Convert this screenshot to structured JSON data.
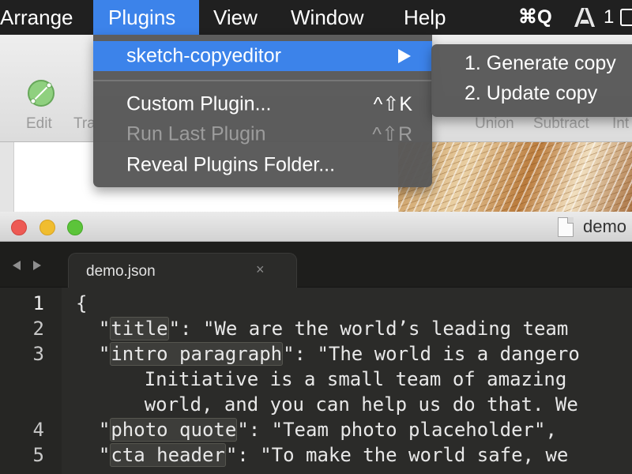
{
  "menubar": {
    "items": [
      {
        "label": "Arrange"
      },
      {
        "label": "Plugins"
      },
      {
        "label": "View"
      },
      {
        "label": "Window"
      },
      {
        "label": "Help"
      }
    ],
    "tray": {
      "shortcut_text": "⌘Q",
      "adobe_icon": "adobe-icon",
      "count_text": "1"
    }
  },
  "sketch_toolbar": {
    "left_labels": [
      "Edit",
      "Tra"
    ],
    "right_labels": [
      "Union",
      "Subtract",
      "Int"
    ]
  },
  "plugins_menu": {
    "highlighted": {
      "label": "sketch-copyeditor",
      "icon": "submenu-arrow-icon"
    },
    "items": [
      {
        "label": "Custom Plugin...",
        "shortcut": "^⇧K",
        "enabled": true
      },
      {
        "label": "Run Last Plugin",
        "shortcut": "^⇧R",
        "enabled": false
      },
      {
        "label": "Reveal Plugins Folder...",
        "shortcut": "",
        "enabled": true
      }
    ],
    "submenu": [
      {
        "label": "1. Generate copy"
      },
      {
        "label": "2. Update copy"
      }
    ]
  },
  "editor": {
    "window_title": "demo",
    "tab": {
      "label": "demo.json",
      "close": "×"
    },
    "line_numbers": [
      "1",
      "2",
      "3",
      "4",
      "5"
    ],
    "lines": [
      {
        "pre": "{",
        "key": "",
        "post": ""
      },
      {
        "pre": "  \"",
        "key": "title",
        "post": "\": \"We are the world’s leading team"
      },
      {
        "pre": "  \"",
        "key": "intro paragraph",
        "post": "\": \"The world is a dangero"
      },
      {
        "pre": "      Initiative is a small team of amazing",
        "key": "",
        "post": ""
      },
      {
        "pre": "      world, and you can help us do that. We",
        "key": "",
        "post": ""
      },
      {
        "pre": "  \"",
        "key": "photo quote",
        "post": "\": \"Team photo placeholder\","
      },
      {
        "pre": "  \"",
        "key": "cta header",
        "post": "\": \"To make the world safe, we"
      }
    ]
  },
  "colors": {
    "accent": "#3c83ea",
    "menu_bg": "#585858",
    "editor_bg": "#2b2b29",
    "traffic_close": "#ed5a54",
    "traffic_min": "#f0bd2f",
    "traffic_max": "#5cc43a"
  }
}
